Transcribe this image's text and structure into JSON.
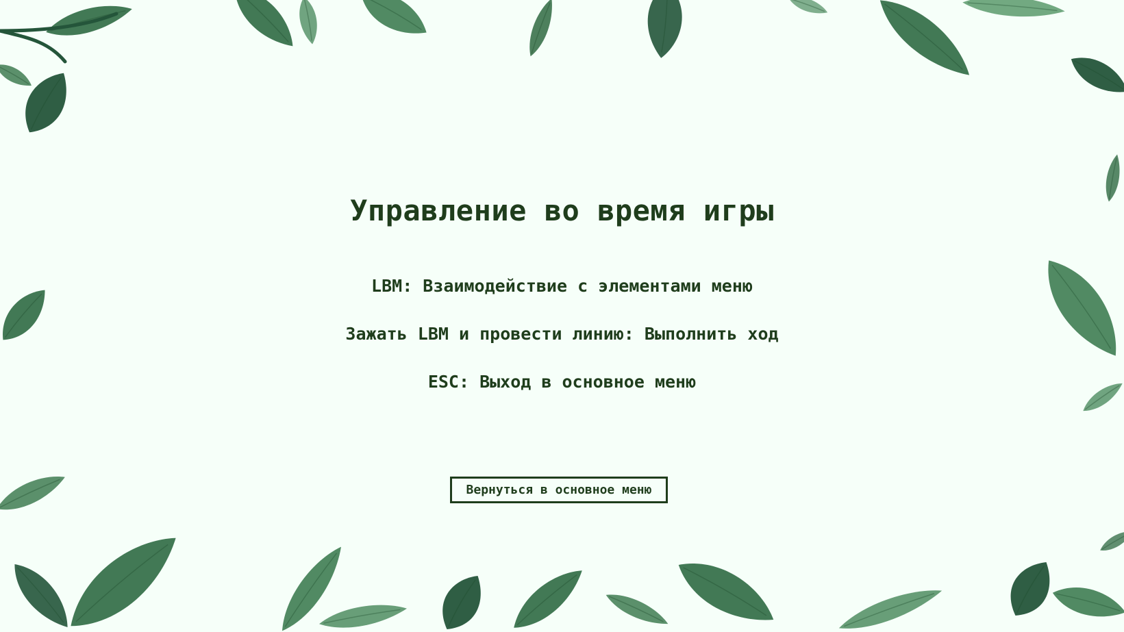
{
  "screen": {
    "title": "Управление во время игры",
    "controls": [
      "LBM: Взаимодействие с элементами меню",
      "Зажать LBM и провести линию: Выполнить ход",
      "ESC: Выход в основное меню"
    ],
    "back_button_label": "Вернуться в основное меню"
  },
  "theme": {
    "background": "#f6fff9",
    "text_color": "#1f3d1c",
    "leaf_colors": [
      "#2f6a42",
      "#3f7d52",
      "#4f8d61",
      "#24553a",
      "#5a9a6c"
    ]
  },
  "decoration": "watercolor-leaves-border"
}
